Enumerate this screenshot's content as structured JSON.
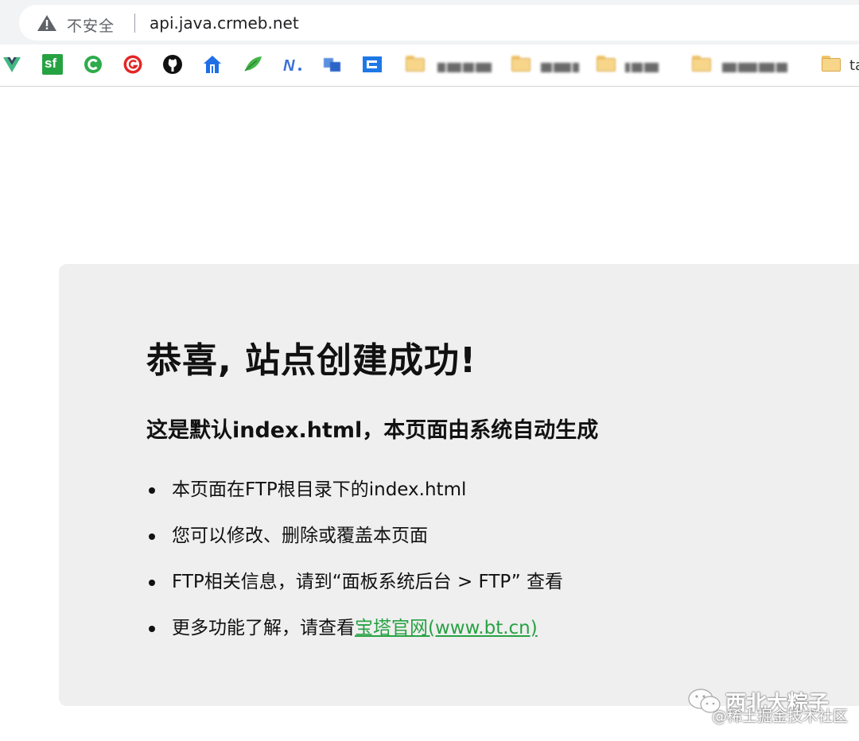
{
  "browser": {
    "security_label": "不安全",
    "url": "api.java.crmeb.net",
    "bookmarks": {
      "sf_label": "sf",
      "cut_text": "ta"
    }
  },
  "page": {
    "heading": "恭喜, 站点创建成功!",
    "subheading": "这是默认index.html，本页面由系统自动生成",
    "items": [
      "本页面在FTP根目录下的index.html",
      "您可以修改、删除或覆盖本页面",
      "FTP相关信息，请到“面板系统后台 > FTP” 查看"
    ],
    "last_item_prefix": "更多功能了解，请查看",
    "link_text": "宝塔官网(www.bt.cn)",
    "link_color": "#27a243",
    "card_color": "#efefef"
  },
  "watermark": {
    "line1": "西北大粽子",
    "line2": "@稀土掘金技术社区"
  }
}
